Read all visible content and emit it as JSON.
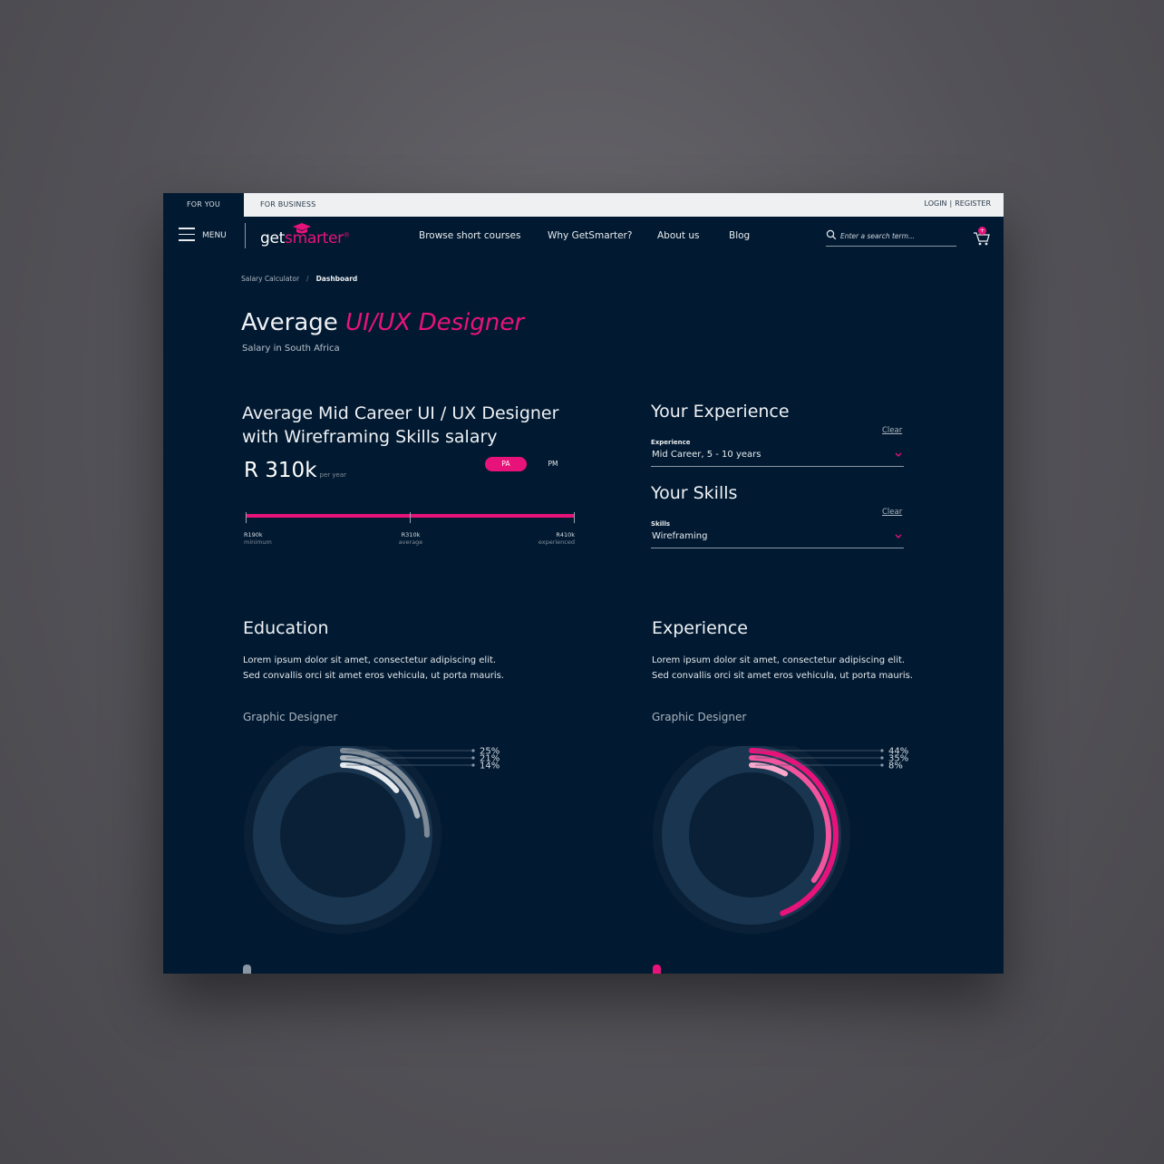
{
  "topbar": {
    "tab_for_you": "FOR YOU",
    "tab_for_business": "FOR BUSINESS",
    "login": "LOGIN",
    "register": "REGISTER"
  },
  "nav": {
    "menu_label": "MENU",
    "logo_get": "get",
    "logo_smarter": "smarter",
    "links": [
      "Browse short courses",
      "Why GetSmarter?",
      "About us",
      "Blog"
    ],
    "search_placeholder": "Enter a search term...",
    "cart_badge": "+"
  },
  "breadcrumb": {
    "parent": "Salary Calculator",
    "current": "Dashboard"
  },
  "heading": {
    "prefix": "Average",
    "role": "UI/UX Designer",
    "subtitle": "Salary in South Africa"
  },
  "salary": {
    "title": "Average Mid Career UI / UX Designer with Wireframing Skills salary",
    "amount": "R 310k",
    "per_year": "per year",
    "toggle_pa": "PA",
    "toggle_pm": "PM",
    "range": [
      {
        "value": "R190k",
        "label": "minimum"
      },
      {
        "value": "R310k",
        "label": "average"
      },
      {
        "value": "R410k",
        "label": "experienced"
      }
    ]
  },
  "experience_panel": {
    "title": "Your Experience",
    "clear": "Clear",
    "field_label": "Experience",
    "field_value": "Mid Career, 5 - 10 years"
  },
  "skills_panel": {
    "title": "Your Skills",
    "clear": "Clear",
    "field_label": "Skills",
    "field_value": "Wireframing"
  },
  "education": {
    "title": "Education",
    "text": "Lorem ipsum dolor sit amet, consectetur adipiscing elit. Sed convallis orci sit amet eros vehicula, ut porta mauris.",
    "chart_title": "Graphic Designer"
  },
  "experience": {
    "title": "Experience",
    "text": "Lorem ipsum dolor sit amet, consectetur adipiscing elit. Sed convallis orci sit amet eros vehicula, ut porta mauris.",
    "chart_title": "Graphic Designer"
  },
  "colors": {
    "accent": "#e8137a",
    "background": "#021a31"
  },
  "chart_data": [
    {
      "type": "pie",
      "title": "Graphic Designer",
      "labels": [
        "25%",
        "21%",
        "14%"
      ],
      "values": [
        25,
        21,
        14
      ],
      "colors": [
        "#7e8a96",
        "#aab3bc",
        "#e6eaee"
      ]
    },
    {
      "type": "pie",
      "title": "Graphic Designer",
      "labels": [
        "44%",
        "35%",
        "8%"
      ],
      "values": [
        44,
        35,
        8
      ],
      "colors": [
        "#e8137a",
        "#f2559d",
        "#f7a8cb"
      ]
    }
  ]
}
